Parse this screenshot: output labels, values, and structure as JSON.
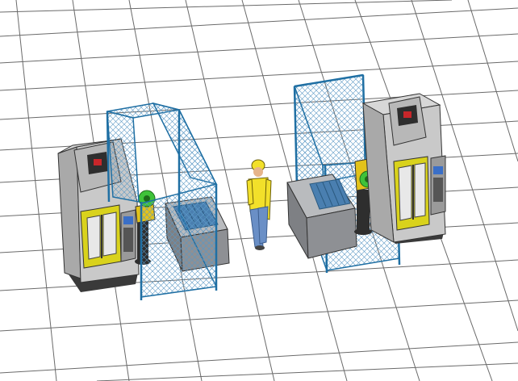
{
  "scene": {
    "view": "isometric-3d",
    "background": "#ffffff",
    "grid_color": "#6a6a6a",
    "objects": [
      "floor-grid",
      "left-cnc-machine",
      "left-safety-fence",
      "left-robot-arm",
      "left-parts-table",
      "operator-figure",
      "right-cnc-machine",
      "right-safety-fence",
      "right-robot-arm",
      "right-parts-table"
    ]
  },
  "colors": {
    "machine_body": "#c9c9c9",
    "machine_dark": "#2e2e2e",
    "door_yellow": "#d9d21c",
    "fence_frame": "#1f6fa3",
    "fence_mesh": "#5a97c4",
    "robot_yellow": "#e2c21a",
    "robot_grip": "#3fc23a",
    "table_gray": "#8e9094",
    "worker_shirt": "#f2e02a",
    "worker_pants": "#6a8fc6",
    "panel_blue": "#3a6fc7",
    "warning_red": "#c8262a"
  }
}
